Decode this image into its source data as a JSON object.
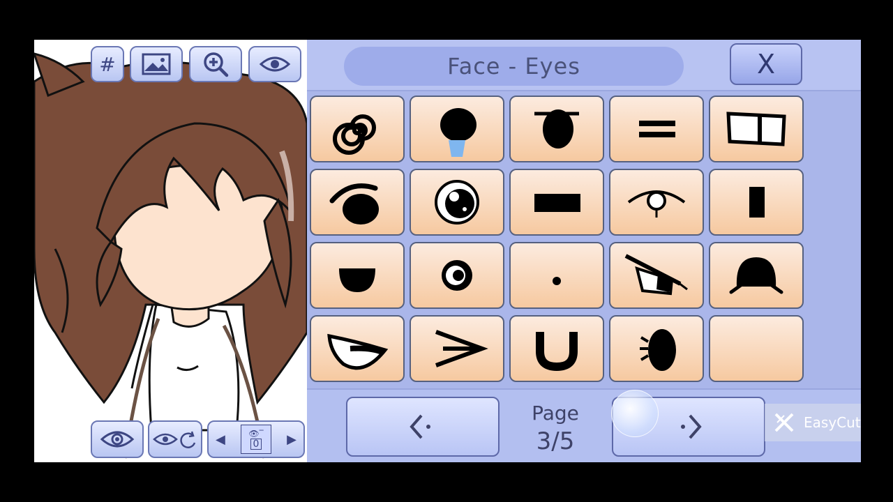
{
  "preview": {
    "toolbar_top": [
      {
        "name": "grid-toggle-button",
        "icon": "hash-icon",
        "label": "#"
      },
      {
        "name": "background-button",
        "icon": "image-icon"
      },
      {
        "name": "zoom-button",
        "icon": "zoom-in-icon"
      },
      {
        "name": "visibility-button",
        "icon": "eye-icon"
      }
    ],
    "toolbar_bottom": {
      "preview_eye_icon": "eye-icon",
      "reset_view_icon": "eye-rotate-icon",
      "expression_value": "0"
    }
  },
  "panel": {
    "title": "Face - Eyes",
    "close_label": "X",
    "eye_options": [
      "spiral-eye-icon",
      "teary-eye-icon",
      "lidded-eye-icon",
      "equals-eye-icon",
      "white-box-eye-icon",
      "browed-eye-icon",
      "shiny-eye-icon",
      "dash-eye-icon",
      "thin-eye-icon",
      "bar-eye-icon",
      "half-circle-eye-icon",
      "ring-eye-icon",
      "dot-eye-icon",
      "glaring-eye-icon",
      "dome-eye-icon",
      "squint-eye-icon",
      "arrow-eye-icon",
      "u-shape-eye-icon",
      "lashed-oval-eye-icon",
      "empty-slot"
    ],
    "page_label": "Page",
    "page_number": "3/5",
    "prev_icon": "chevron-left-icon",
    "next_icon": "chevron-right-icon",
    "watermark": "EasyCut"
  },
  "colors": {
    "panel_bg": "#aab6ea",
    "cell_top": "#fcebdf",
    "cell_bottom": "#f6c9a0",
    "hair": "#6b4434",
    "skin": "#fde3cf"
  }
}
